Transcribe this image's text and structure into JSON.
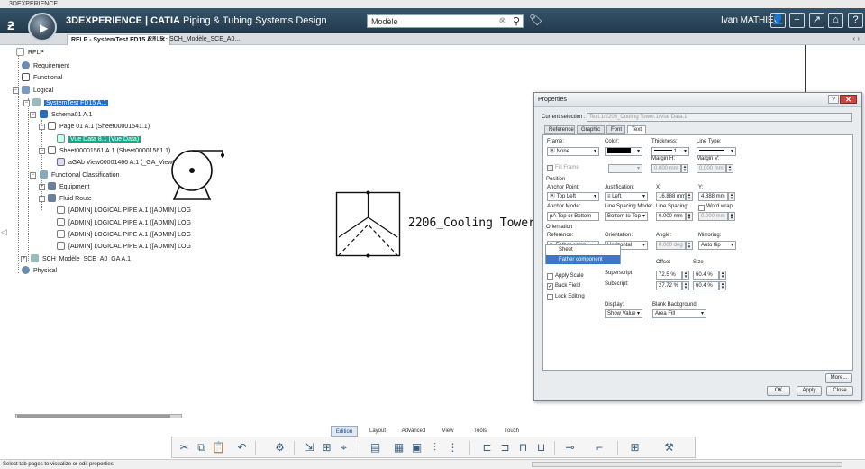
{
  "window": {
    "title": "3DEXPERIENCE"
  },
  "topbar": {
    "brand_bold": "3DEXPERIENCE | CATIA",
    "brand_light": " Piping & Tubing Systems Design",
    "search_value": "Modèle",
    "user": "Ivan MATHIEU"
  },
  "tabs": [
    {
      "label": "RFLP - SystemTest FD15 A.1",
      "active": true
    },
    {
      "label": "RFLP - SCH_Modèle_SCE_A0...",
      "active": false
    }
  ],
  "tree": {
    "root": "RFLP",
    "requirement": "Requirement",
    "functional": "Functional",
    "logical": "Logical",
    "systemtest": "SystemTest FD15 A.1",
    "schema": "Schema01 A.1",
    "page": "Page 01 A.1 (Sheet00001541.1)",
    "vue": "Vue Data 8.1 (Vue Data)",
    "sheet": "Sheet00001561 A.1 (Sheet00001561.1)",
    "agab": "aGAb View00001466 A.1 (_GA_View0001",
    "func_class": "Functional Classification",
    "equipment": "Equipment",
    "fluid_route": "Fluid Route",
    "pipes": [
      "[ADMIN] LOGICAL PIPE A.1 ([ADMIN] LOG",
      "[ADMIN] LOGICAL PIPE A.1 ([ADMIN] LOG",
      "[ADMIN] LOGICAL PIPE A.1 ([ADMIN] LOG",
      "[ADMIN] LOGICAL PIPE A.1 ([ADMIN] LOG"
    ],
    "sch": "SCH_Modèle_SCE_A0_GA A.1",
    "physical": "Physical"
  },
  "canvas": {
    "tower_label": "2206_Cooling Tower.1"
  },
  "dialog": {
    "title": "Properties",
    "current_selection_label": "Current selection :",
    "current_selection_value": "Text.1/2206_Cooling Tower.1/Vue Data.1",
    "tabs": [
      "Reference",
      "Graphic",
      "Font",
      "Text"
    ],
    "active_tab": "Text",
    "frame_label": "Frame:",
    "frame_value": "None",
    "color_label": "Color:",
    "thickness_label": "Thickness:",
    "thickness_value": "1",
    "line_type_label": "Line Type:",
    "fill_frame": "Fill Frame",
    "margin_h_label": "Margin H:",
    "margin_h_value": "0.000 mm",
    "margin_v_label": "Margin V:",
    "margin_v_value": "0.000 mm",
    "position_label": "Position",
    "anchor_point_label": "Anchor Point:",
    "anchor_point_value": "Top Left",
    "justification_label": "Justification:",
    "justification_value": "Left",
    "x_label": "X:",
    "x_value": "16.888 mm",
    "y_label": "Y:",
    "y_value": "4.888 mm",
    "anchor_mode_label": "Anchor Mode:",
    "anchor_mode_value": "Top or Bottom",
    "line_spacing_mode_label": "Line Spacing Mode:",
    "line_spacing_mode_value": "Bottom to Top",
    "line_spacing_label": "Line Spacing:",
    "line_spacing_value": "0.000 mm",
    "word_wrap": "Word wrap:",
    "word_wrap_value": "0.000 mm",
    "orientation_label": "Orientation",
    "reference_label": "Reference:",
    "reference_value": "Father comp",
    "orientation_sub_label": "Orientation:",
    "orientation_value": "Horizontal",
    "angle_label": "Angle:",
    "angle_value": "0.000 deg",
    "mirroring_label": "Mirroring:",
    "mirroring_value": "Auto flip",
    "popup_options": [
      "Sheet",
      "Father component"
    ],
    "offset_label": "Offset",
    "size_label": "Size",
    "apply_scale": "Apply Scale",
    "back_field": "Back Field",
    "lock_editing": "Lock Editing",
    "superscript_label": "Superscript:",
    "superscript_offset": "72.5 %",
    "superscript_size": "60.4 %",
    "subscript_label": "Subscript:",
    "subscript_offset": "27.72 %",
    "subscript_size": "60.4 %",
    "display_label": "Display:",
    "display_value": "Show Value",
    "blank_bg_label": "Blank Background:",
    "blank_bg_value": "Area Fill",
    "more_button": "More...",
    "ok_button": "OK",
    "apply_button": "Apply",
    "close_button": "Close"
  },
  "action_tabs": [
    "Edition",
    "Layout",
    "Advanced",
    "View",
    "Tools",
    "Touch"
  ],
  "active_action_tab": "Edition",
  "status": "Select tab pages to visualize or edit properties",
  "colors": {
    "accent": "#1f6fd1",
    "highlight": "#17a88a",
    "topbar": "#2c4658"
  }
}
